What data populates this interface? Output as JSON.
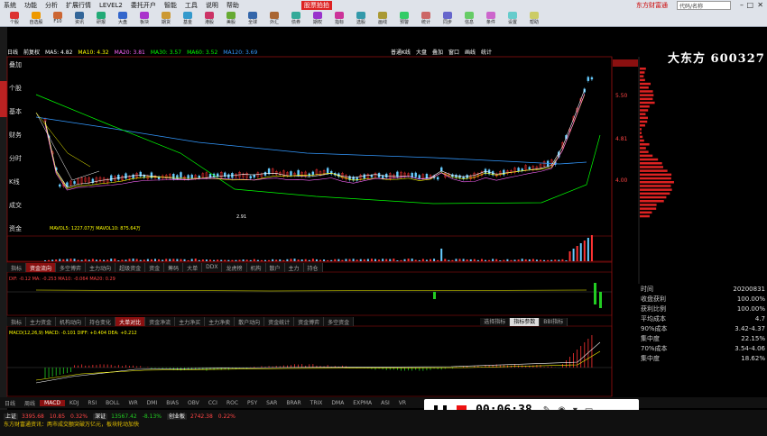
{
  "menu": {
    "items": [
      "系统",
      "功能",
      "分析",
      "扩展行情",
      "LEVEL2",
      "委托开户",
      "智能",
      "工具",
      "说明",
      "帮助"
    ],
    "badge": "股票拍拍",
    "right_text": "东方财富通",
    "search_placeholder": "代码/名称"
  },
  "toolbar": {
    "labels": [
      "个股",
      "自选股",
      "F10",
      "资讯",
      "研报",
      "大盘",
      "板块",
      "期货",
      "基金",
      "港股",
      "美股",
      "全球",
      "外汇",
      "债券",
      "期权",
      "指标",
      "选股",
      "画线",
      "预警",
      "统计",
      "同步",
      "信息",
      "条件",
      "设置",
      "帮助"
    ]
  },
  "infobar": {
    "items": [
      "日线",
      "前复权",
      "MA5: 4.82",
      "MA10: 4.32",
      "MA20: 3.81",
      "MA30: 3.57",
      "MA60: 3.52",
      "MA120: 3.69"
    ],
    "right": [
      "普通K线",
      "大盘",
      "叠加",
      "窗口",
      "画线",
      "统计"
    ]
  },
  "stock": {
    "title": "大东方 600327"
  },
  "left_labels": [
    "叠加",
    "个股",
    "基本",
    "财务",
    "分时",
    "K线",
    "成交",
    "资金"
  ],
  "price_labels": [
    "5.50",
    "4.81",
    "4.00"
  ],
  "low_label": "2.91",
  "vol_legend": "MAVOL5: 1227.07万 MAVOL10: 875.64万",
  "mid_tabs": [
    "指标",
    "资金流向",
    "多空博弈",
    "主力动向",
    "超级资金",
    "资金",
    "筹码",
    "大单",
    "DDX",
    "龙虎榜",
    "机构",
    "散户",
    "主力",
    "持仓"
  ],
  "ind1_legend": "DIF: -0.12 MA: -0.253 MA10: -0.064 MA20: 0.29",
  "lower_tabs": [
    "指标",
    "主力资金",
    "机构动向",
    "持仓变化",
    "大单对比",
    "资金净流",
    "主力净买",
    "主力净卖",
    "散户动向",
    "资金统计",
    "资金博弈",
    "多空资金"
  ],
  "lower_buttons": [
    "选择指标",
    "指标参数",
    "BBI指标"
  ],
  "macd_legend": "MACD(12,26,9) MACD: -0.101 DIFF: +0.404 DEA: +0.212",
  "right_panel": {
    "rows": [
      {
        "k": "时间",
        "v": "20200831"
      },
      {
        "k": "收盘获利",
        "v": "100.00%"
      },
      {
        "k": "获利比例",
        "v": "100.00%"
      },
      {
        "k": "平均成本",
        "v": "4.7"
      },
      {
        "k": "90%成本",
        "v": "3.42-4.37"
      },
      {
        "k": "集中度",
        "v": "22.15%"
      },
      {
        "k": "70%成本",
        "v": "3.54-4.06"
      },
      {
        "k": "集中度",
        "v": "18.62%"
      }
    ]
  },
  "bottom_tabs": [
    "日线",
    "周线",
    "MACD",
    "KDJ",
    "RSI",
    "BOLL",
    "WR",
    "DMI",
    "BIAS",
    "OBV",
    "CCI",
    "ROC",
    "PSY",
    "SAR",
    "BRAR",
    "TRIX",
    "DMA",
    "EXPMA",
    "ASI",
    "VR"
  ],
  "bottom_tab_active": "MACD",
  "recorder": {
    "time": "00:06:38"
  },
  "ticker": {
    "label": "上证",
    "items": [
      {
        "t": "3395.68",
        "c": "up"
      },
      {
        "t": "10.85",
        "c": "up"
      },
      {
        "t": "0.32%",
        "c": "up"
      },
      {
        "t": "深证",
        "c": "lbl"
      },
      {
        "t": "13567.42",
        "c": "dn"
      },
      {
        "t": "-8.13%",
        "c": "dn"
      },
      {
        "t": "创业板",
        "c": "lbl"
      },
      {
        "t": "2742.38",
        "c": "up"
      },
      {
        "t": "0.22%",
        "c": "up"
      }
    ],
    "news": "东方财富通资讯：两市成交额突破万亿元，板块轮动加快"
  },
  "colors": {
    "up": "#ff3333",
    "down": "#22cc22",
    "ma5": "#ffffff",
    "ma10": "#ffff00",
    "ma20": "#ff66ff",
    "ma60": "#00ff00",
    "ma120": "#3399ff"
  }
}
